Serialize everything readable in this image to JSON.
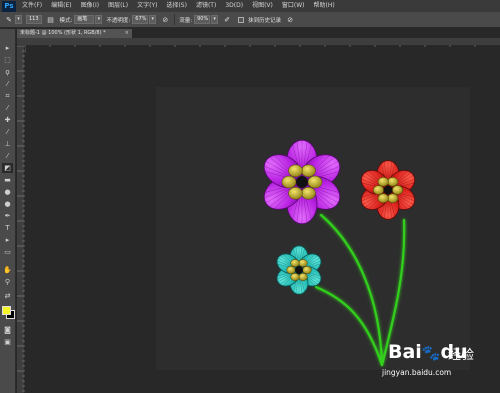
{
  "app": {
    "logo": "Ps"
  },
  "menu": [
    "文件(F)",
    "编辑(E)",
    "图像(I)",
    "图层(L)",
    "文字(Y)",
    "选择(S)",
    "滤镜(T)",
    "3D(D)",
    "视图(V)",
    "窗口(W)",
    "帮助(H)"
  ],
  "options": {
    "brush_size": "113",
    "mode_label": "模式:",
    "mode_value": "画笔",
    "opacity_label": "不透明度:",
    "opacity_value": "67%",
    "erase_label": "流量:",
    "erase_value": "90%",
    "history_label": "抹到历史记录"
  },
  "document": {
    "tab_title": "未标题-1 @ 100% (形状 1, RGB/8) *",
    "close": "×"
  },
  "colors": {
    "foreground": "#f5f52a",
    "background": "#000000",
    "canvas": "#2d2d2d"
  },
  "flowers": [
    {
      "name": "purple-flower",
      "petal_color": "#b61fe0",
      "center_color": "#d1b938",
      "petals": 6
    },
    {
      "name": "red-flower",
      "petal_color": "#d9201c",
      "center_color": "#d1b938",
      "petals": 6
    },
    {
      "name": "cyan-flower",
      "petal_color": "#1fb8b0",
      "center_color": "#d1c235",
      "petals": 6
    }
  ],
  "stem_color": "#33d01f",
  "watermark": {
    "brand": "Bai",
    "brand2": "du",
    "jingyan": "经验",
    "url": "jingyan.baidu.com"
  }
}
